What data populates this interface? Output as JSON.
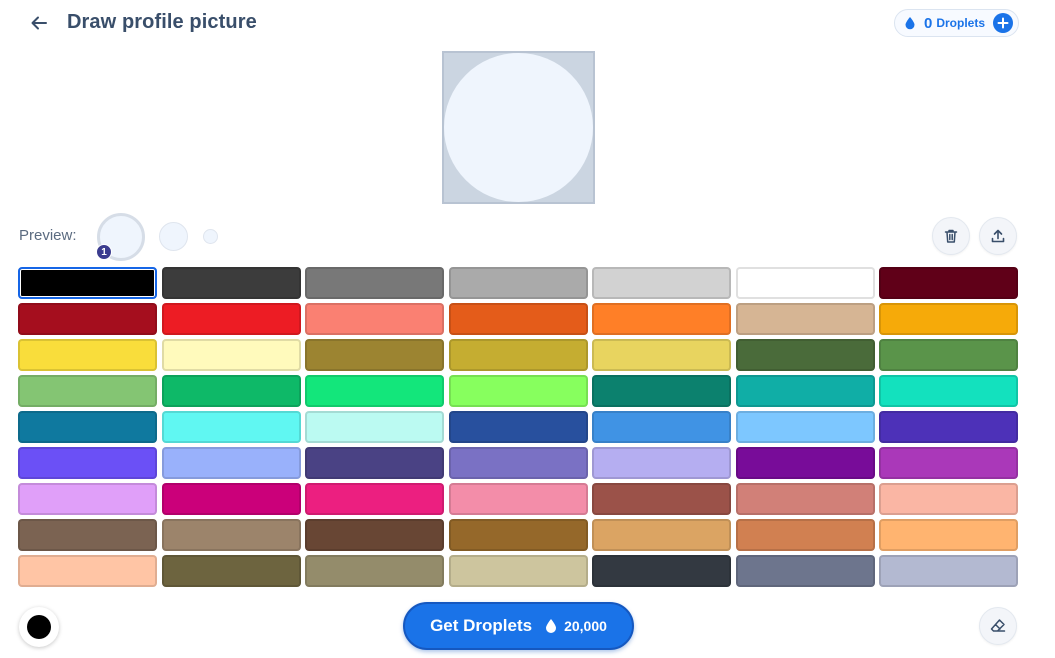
{
  "header": {
    "title": "Draw profile picture",
    "back_icon": "arrow-left-icon",
    "droplets": {
      "count": "0",
      "label": "Droplets",
      "icon": "droplet-icon",
      "add_icon": "plus-icon"
    }
  },
  "preview": {
    "label": "Preview:",
    "badge": "1"
  },
  "toolbar": {
    "trash_icon": "trash-icon",
    "upload_icon": "upload-icon",
    "eraser_icon": "eraser-icon"
  },
  "palette": {
    "selected_index": 0,
    "colors": [
      "#000000",
      "#3c3c3c",
      "#787878",
      "#aaaaaa",
      "#d2d2d2",
      "#ffffff",
      "#600018",
      "#a50e1e",
      "#ed1c24",
      "#fa8072",
      "#e45c1a",
      "#ff7f27",
      "#d6b594",
      "#f6aa09",
      "#f9dd3b",
      "#fffabc",
      "#9c8431",
      "#c5ad31",
      "#e8d45f",
      "#4a6b3a",
      "#5a944a",
      "#84c573",
      "#0eb968",
      "#13e67b",
      "#87ff5e",
      "#0c816e",
      "#10aea6",
      "#13e1be",
      "#0f799f",
      "#60f7f2",
      "#bbfaf2",
      "#28509e",
      "#4093e4",
      "#7dc7ff",
      "#4d31b8",
      "#6b50f6",
      "#99b1fb",
      "#4a4284",
      "#7a71c4",
      "#b5aef1",
      "#780c99",
      "#aa38b9",
      "#e09ff9",
      "#cb007a",
      "#ec1f80",
      "#f38da9",
      "#9b5249",
      "#d18078",
      "#fab6a4",
      "#7b6352",
      "#9c846b",
      "#684634",
      "#95682a",
      "#dba463",
      "#d18051",
      "#ffb470",
      "#ffc5a5",
      "#6d643f",
      "#948c6b",
      "#cdc59e",
      "#333941",
      "#6d758d",
      "#b3b9d1"
    ]
  },
  "current_color": "#000000",
  "get_droplets": {
    "label": "Get Droplets",
    "price": "20,000",
    "icon": "droplet-icon"
  }
}
